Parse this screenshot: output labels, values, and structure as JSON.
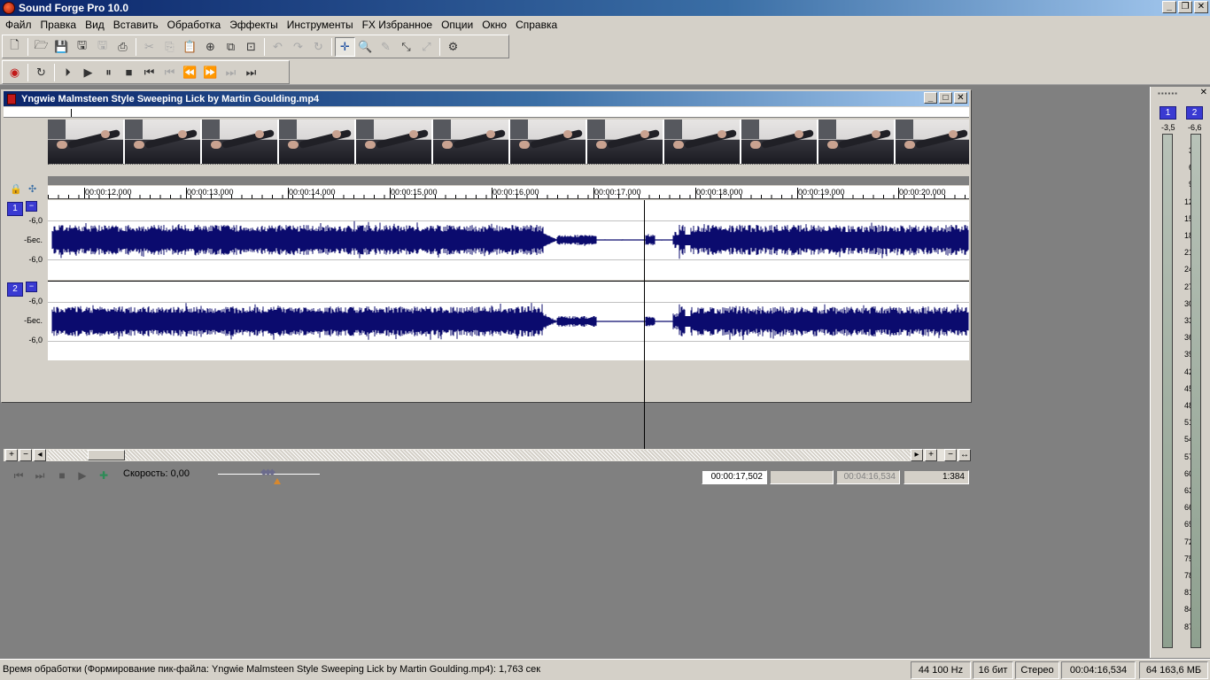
{
  "app": {
    "title": "Sound Forge Pro 10.0"
  },
  "menu": [
    "Файл",
    "Правка",
    "Вид",
    "Вставить",
    "Обработка",
    "Эффекты",
    "Инструменты",
    "FX Избранное",
    "Опции",
    "Окно",
    "Справка"
  ],
  "toolbar_icons": {
    "row1": [
      "new-file-icon",
      "open-folder-icon",
      "save-icon",
      "save-as-icon",
      "render-icon",
      "print-icon",
      "cut-icon",
      "copy-icon",
      "paste-icon",
      "paste-mix-icon",
      "paste-crossfade-icon",
      "trim-crop-icon",
      "undo-icon",
      "redo-icon",
      "repeat-icon",
      "edit-tool-icon",
      "magnify-tool-icon",
      "pencil-tool-icon",
      "envelope-tool-icon",
      "event-tool-icon",
      "plugin-chainer-icon"
    ],
    "row2": [
      "record-icon",
      "loop-icon",
      "play-all-icon",
      "play-icon",
      "pause-icon",
      "stop-icon",
      "go-to-start-icon",
      "previous-frame-icon",
      "rewind-icon",
      "forward-icon",
      "next-frame-icon",
      "go-to-end-icon"
    ]
  },
  "document": {
    "title": "Yngwie Malmsteen Style Sweeping Lick by Martin Goulding.mp4",
    "ruler_labels": [
      "00:00:12,000",
      "00:00:13,000",
      "00:00:14,000",
      "00:00:15,000",
      "00:00:16,000",
      "00:00:17,000",
      "00:00:18,000",
      "00:00:19,000",
      "00:00:20,000"
    ],
    "channels": [
      {
        "num": "1",
        "min": "−",
        "db_top": "-6,0",
        "db_mid": "-Бес.",
        "db_bot": "-6,0"
      },
      {
        "num": "2",
        "min": "−",
        "db_top": "-6,0",
        "db_mid": "-Бес.",
        "db_bot": "-6,0"
      }
    ],
    "transport": {
      "speed_label": "Скорость: 0,00"
    },
    "fields": {
      "cursor_position": "00:00:17,502",
      "selection_length": "",
      "file_length": "00:04:16,534",
      "zoom_ratio": "1:384"
    }
  },
  "meters": {
    "ch1": {
      "label": "1",
      "peak": "-3,5"
    },
    "ch2": {
      "label": "2",
      "peak": "-6,6"
    },
    "scale": [
      "3",
      "6",
      "9",
      "12",
      "15",
      "18",
      "21",
      "24",
      "27",
      "30",
      "33",
      "36",
      "39",
      "42",
      "45",
      "48",
      "51",
      "54",
      "57",
      "60",
      "63",
      "66",
      "69",
      "72",
      "75",
      "78",
      "81",
      "84",
      "87"
    ]
  },
  "status": {
    "text": "Время обработки (Формирование пик-файла:   Yngwie Malmsteen Style Sweeping Lick by Martin Goulding.mp4): 1,763 сек",
    "sample_rate": "44 100 Hz",
    "bit_depth": "16 бит",
    "channels": "Стерео",
    "length": "00:04:16,534",
    "free_space": "64 163,6 МБ"
  },
  "colors": {
    "waveform": "#0b0b6e",
    "title_gradient_start": "#0a246a",
    "channel_button": "#3a3ad2"
  }
}
